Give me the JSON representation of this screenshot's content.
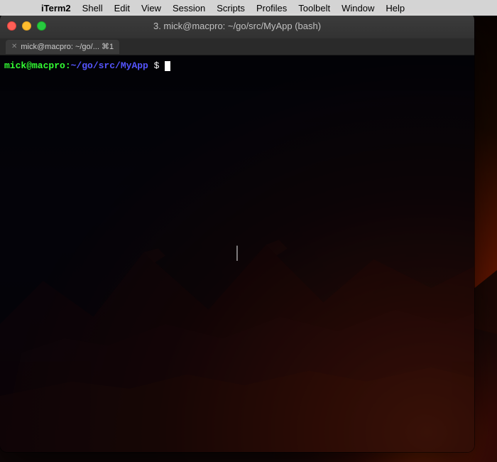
{
  "desktop": {
    "label": "macOS Desktop"
  },
  "menubar": {
    "apple_symbol": "",
    "items": [
      {
        "id": "iterm2",
        "label": "iTerm2",
        "bold": true
      },
      {
        "id": "shell",
        "label": "Shell"
      },
      {
        "id": "edit",
        "label": "Edit"
      },
      {
        "id": "view",
        "label": "View"
      },
      {
        "id": "session",
        "label": "Session"
      },
      {
        "id": "scripts",
        "label": "Scripts"
      },
      {
        "id": "profiles",
        "label": "Profiles"
      },
      {
        "id": "toolbelt",
        "label": "Toolbelt"
      },
      {
        "id": "window",
        "label": "Window"
      },
      {
        "id": "help",
        "label": "Help"
      }
    ]
  },
  "window": {
    "title": "3. mick@macpro: ~/go/src/MyApp (bash)",
    "tab_label": "mick@macpro: ~/go/...  ⌘1"
  },
  "terminal": {
    "prompt_user": "mick@macpro:",
    "prompt_path": "~/go/src/MyApp",
    "prompt_dollar": " $ ",
    "cursor_char": "I"
  }
}
